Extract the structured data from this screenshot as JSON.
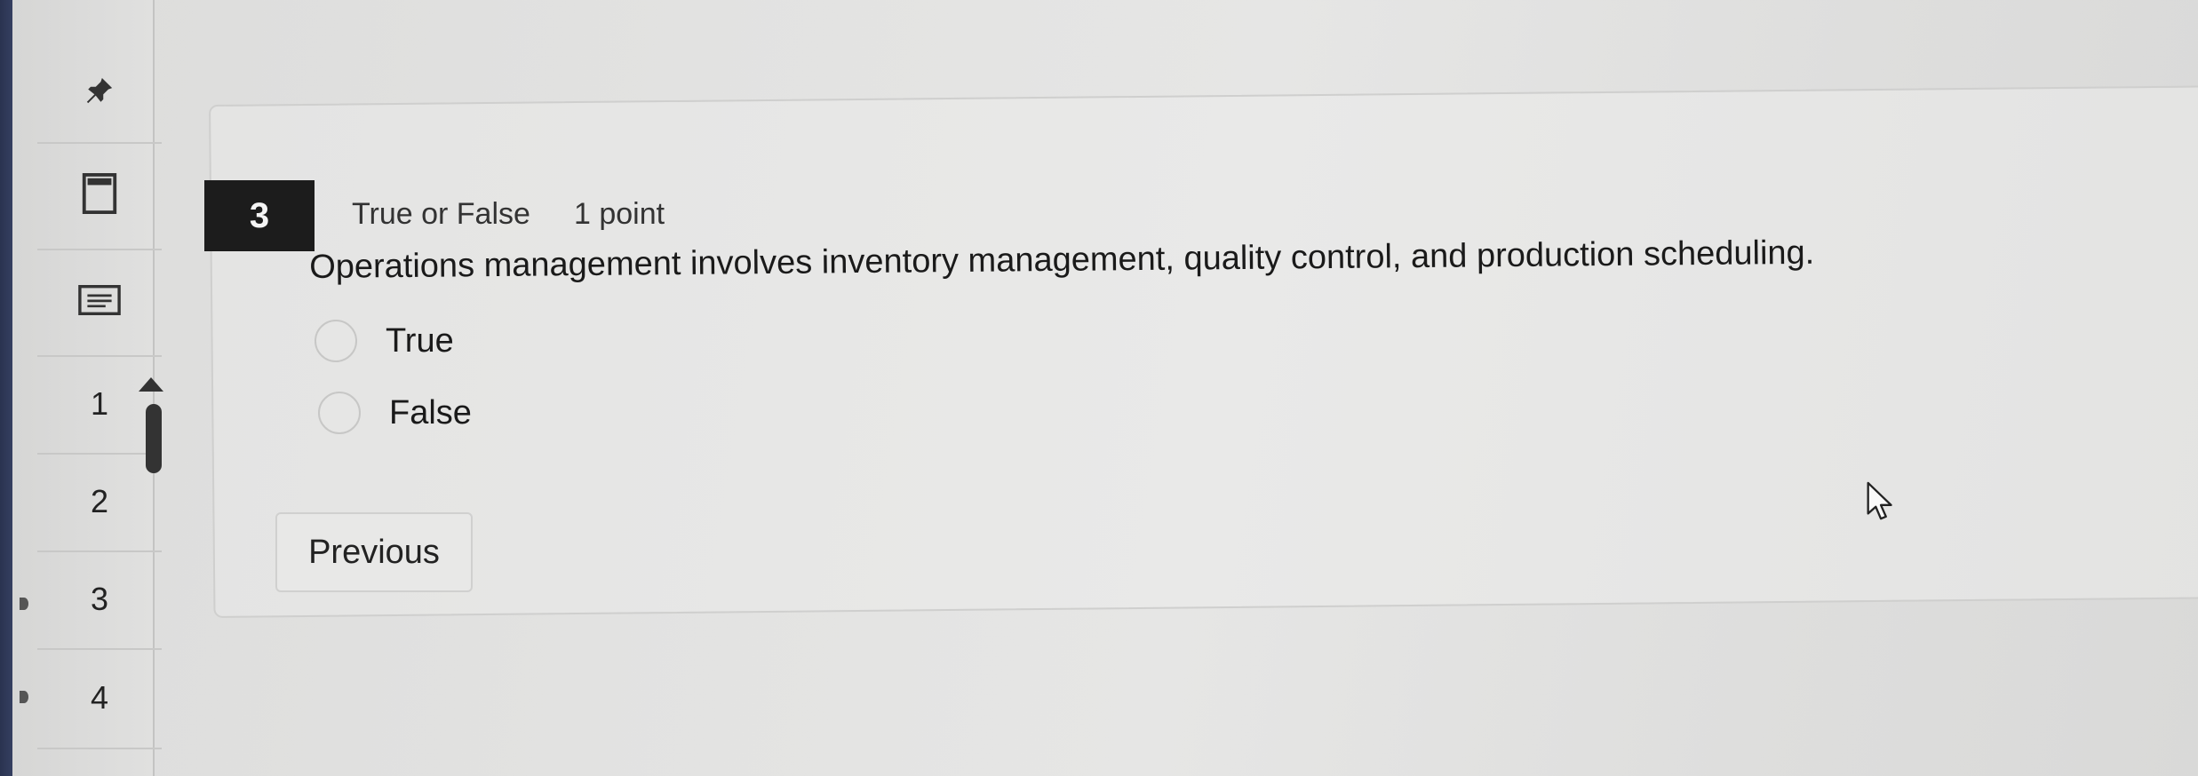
{
  "sidebar": {
    "items": [
      {
        "icon": "pin-icon"
      },
      {
        "icon": "calculator-icon"
      },
      {
        "icon": "notepad-icon"
      },
      {
        "label": "1"
      },
      {
        "label": "2"
      },
      {
        "label": "3"
      },
      {
        "label": "4"
      }
    ]
  },
  "question": {
    "number": "3",
    "type": "True or False",
    "points": "1 point",
    "text": "Operations management involves inventory management, quality control, and production scheduling.",
    "options": [
      {
        "label": "True",
        "selected": false
      },
      {
        "label": "False",
        "selected": false
      }
    ]
  },
  "nav": {
    "previous_label": "Previous"
  },
  "colors": {
    "question_badge": "#1c1c1c",
    "background": "#e2e2e1"
  }
}
